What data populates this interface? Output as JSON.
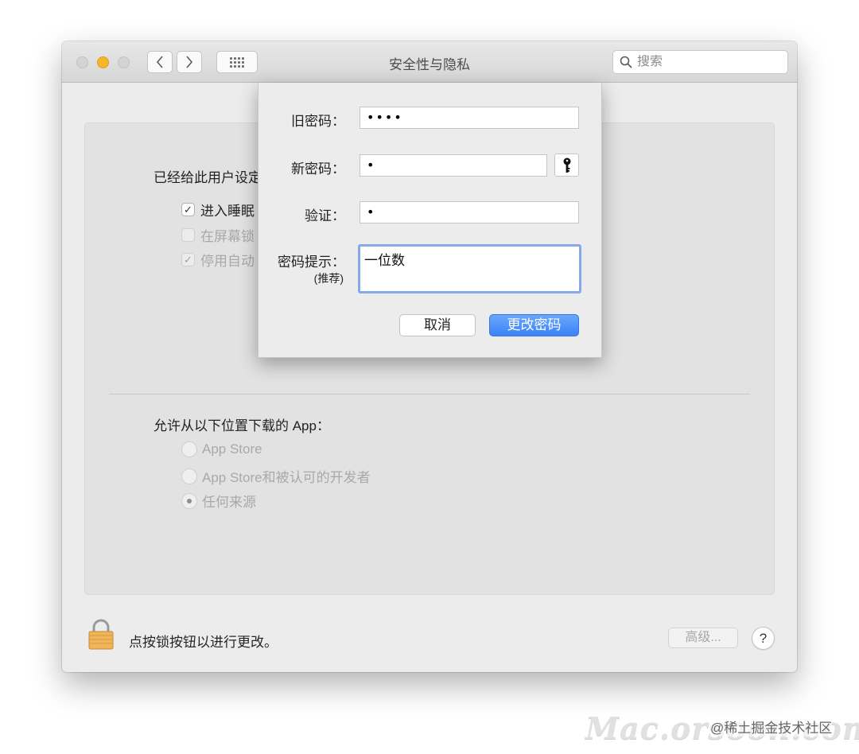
{
  "window": {
    "title": "安全性与隐私",
    "search_placeholder": "搜索"
  },
  "panel": {
    "password_section_label": "已经给此用户设定",
    "options": [
      {
        "label": "进入睡眠",
        "checked": true,
        "enabled": true
      },
      {
        "label": "在屏幕锁",
        "checked": false,
        "enabled": false
      },
      {
        "label": "停用自动",
        "checked": true,
        "enabled": false
      }
    ],
    "download_section_label": "允许从以下位置下载的 App：",
    "download_options": [
      {
        "label": "App Store",
        "selected": false
      },
      {
        "label": "App Store和被认可的开发者",
        "selected": false
      },
      {
        "label": "任何来源",
        "selected": true
      }
    ]
  },
  "bottom": {
    "lock_label": "点按锁按钮以进行更改。",
    "advanced_label": "高级...",
    "help_label": "?"
  },
  "dialog": {
    "old_password_label": "旧密码：",
    "old_password_value": "••••",
    "new_password_label": "新密码：",
    "new_password_value": "•",
    "verify_label": "验证：",
    "verify_value": "•",
    "hint_label": "密码提示：",
    "hint_sublabel": "(推荐)",
    "hint_value": "一位数",
    "cancel_label": "取消",
    "change_label": "更改密码"
  },
  "watermark": {
    "site": "Mac.orsoon.com",
    "credit": "@稀土掘金技术社区"
  },
  "colors": {
    "accent": "#3b82f6",
    "minimize": "#f6b629",
    "focus_ring": "#86a9ea"
  }
}
